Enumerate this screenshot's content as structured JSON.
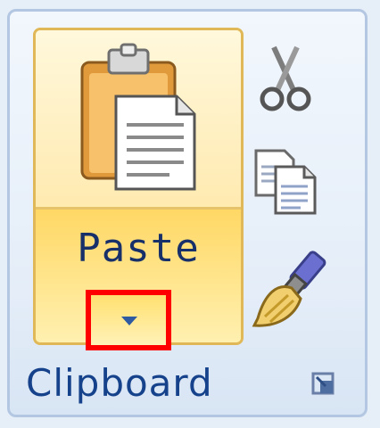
{
  "ribbon": {
    "group": {
      "label": "Clipboard",
      "paste": {
        "label": "Paste",
        "dropdown_icon": "chevron-down-icon"
      },
      "clipboard_icon": "clipboard-icon",
      "cut_icon": "scissors-icon",
      "copy_icon": "copy-icon",
      "format_painter_icon": "paintbrush-icon",
      "launcher_icon": "dialog-launcher-icon"
    },
    "colors": {
      "label_text": "#15428b",
      "highlight": "#ff0000",
      "hover_fill": "#ffe396"
    }
  }
}
